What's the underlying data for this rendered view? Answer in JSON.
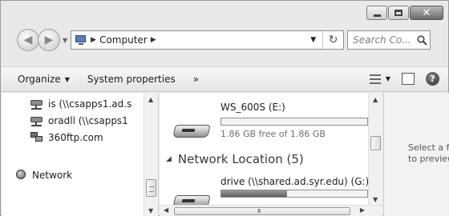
{
  "window": {
    "caption_close": "✕"
  },
  "addressbar": {
    "location": "Computer",
    "search_placeholder": "Search Co..."
  },
  "toolbar": {
    "organize": "Organize",
    "system_properties": "System properties",
    "more": "»"
  },
  "navpane": {
    "items": [
      {
        "label": "is (\\\\csapps1.ad.s",
        "icon": "network-drive-icon"
      },
      {
        "label": "oradll (\\\\csapps1",
        "icon": "network-drive-icon"
      },
      {
        "label": "360ftp.com",
        "icon": "network-location-icon"
      },
      {
        "label": "Network",
        "icon": "network-icon"
      }
    ]
  },
  "content": {
    "drives": [
      {
        "name": "WS_600S (E:)",
        "free_text": "1.86 GB free of 1.86 GB",
        "used_fraction": 0.0
      },
      {
        "name": "drive (\\\\shared.ad.syr.edu) (G:)",
        "used_fraction": 0.45
      }
    ],
    "group_header": "Network Location (5)"
  },
  "preview": {
    "line1": "Select a file",
    "line2": "to preview."
  },
  "colors": {
    "window_bg": "#e9e9e9",
    "bar_fill": "#7a7a7a"
  }
}
